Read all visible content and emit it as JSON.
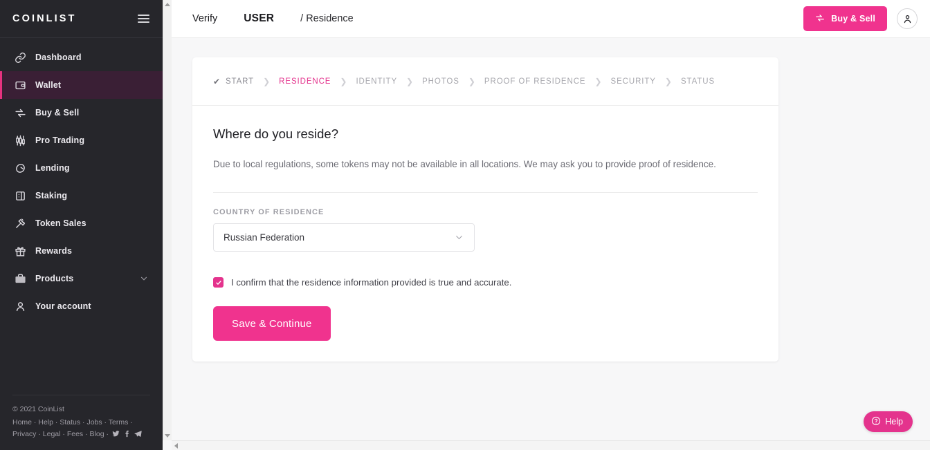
{
  "sidebar": {
    "logo": "COINLIST",
    "menu_icon": "hamburger-icon",
    "items": [
      {
        "label": "Dashboard",
        "icon": "link-icon",
        "active": false
      },
      {
        "label": "Wallet",
        "icon": "wallet-icon",
        "active": true
      },
      {
        "label": "Buy & Sell",
        "icon": "swap-icon",
        "active": false
      },
      {
        "label": "Pro Trading",
        "icon": "candlestick-icon",
        "active": false
      },
      {
        "label": "Lending",
        "icon": "acorn-icon",
        "active": false
      },
      {
        "label": "Staking",
        "icon": "stake-icon",
        "active": false
      },
      {
        "label": "Token Sales",
        "icon": "gavel-icon",
        "active": false
      },
      {
        "label": "Rewards",
        "icon": "gift-icon",
        "active": false
      },
      {
        "label": "Products",
        "icon": "briefcase-icon",
        "active": false,
        "expandable": true
      },
      {
        "label": "Your account",
        "icon": "person-icon",
        "active": false
      }
    ],
    "footer": {
      "copyright": "© 2021 CoinList",
      "links_line1": [
        "Home",
        "Help",
        "Status",
        "Jobs",
        "Terms"
      ],
      "links_line2": [
        "Privacy",
        "Legal",
        "Fees",
        "Blog"
      ],
      "social": [
        "twitter-icon",
        "facebook-icon",
        "telegram-icon"
      ]
    }
  },
  "topbar": {
    "crumb_verify": "Verify",
    "crumb_user": "USER",
    "crumb_section": "/ Residence",
    "buy_sell_label": "Buy & Sell",
    "avatar": "account-avatar"
  },
  "steps": [
    {
      "label": "START",
      "state": "done"
    },
    {
      "label": "RESIDENCE",
      "state": "active"
    },
    {
      "label": "IDENTITY",
      "state": "upcoming"
    },
    {
      "label": "PHOTOS",
      "state": "upcoming"
    },
    {
      "label": "PROOF OF RESIDENCE",
      "state": "upcoming"
    },
    {
      "label": "SECURITY",
      "state": "upcoming"
    },
    {
      "label": "STATUS",
      "state": "upcoming"
    }
  ],
  "form": {
    "heading": "Where do you reside?",
    "description": "Due to local regulations, some tokens may not be available in all locations. We may ask you to provide proof of residence.",
    "country_label": "COUNTRY OF RESIDENCE",
    "country_value": "Russian Federation",
    "confirm_text": "I confirm that the residence information provided is true and accurate.",
    "confirm_checked": true,
    "submit_label": "Save & Continue"
  },
  "help": {
    "label": "Help",
    "icon": "question-circle-icon"
  },
  "colors": {
    "accent_pink": "#f0338e",
    "step_active": "#e4338d",
    "sidebar_bg": "#26262b",
    "sidebar_active_bg": "#3a1f35",
    "page_bg": "#f7f7f8"
  }
}
